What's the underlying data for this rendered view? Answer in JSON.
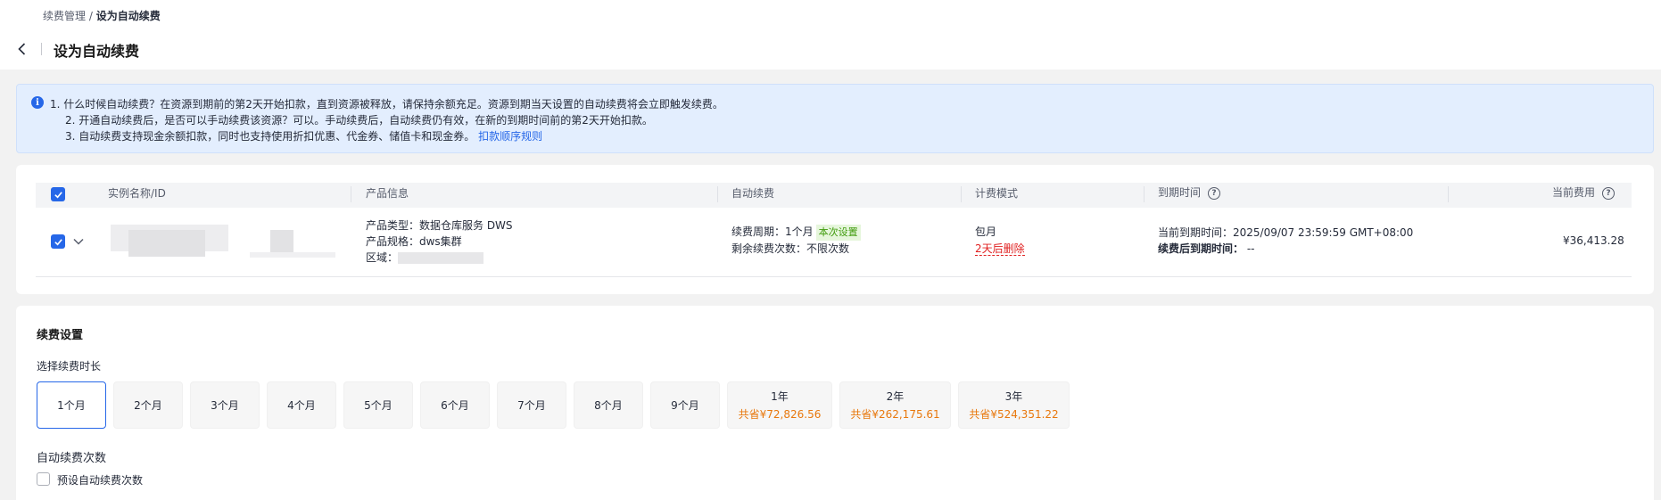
{
  "breadcrumb": {
    "parent": "续费管理",
    "sep": "/",
    "current": "设为自动续费"
  },
  "page_title": "设为自动续费",
  "info": {
    "line1": "1. 什么时候自动续费？在资源到期前的第2天开始扣款，直到资源被释放，请保持余额充足。资源到期当天设置的自动续费将会立即触发续费。",
    "line2": "2. 开通自动续费后，是否可以手动续费该资源？可以。手动续费后，自动续费仍有效，在新的到期时间前的第2天开始扣款。",
    "line3": "3. 自动续费支持现金余额扣款，同时也支持使用折扣优惠、代金券、储值卡和现金券。",
    "line3_link": "扣款顺序规则"
  },
  "table": {
    "headers": {
      "instance": "实例名称/ID",
      "product": "产品信息",
      "auto_renew": "自动续费",
      "billing": "计费模式",
      "expire": "到期时间",
      "fee": "当前费用"
    },
    "row": {
      "product_type": "产品类型：数据仓库服务 DWS",
      "product_spec": "产品规格：dws集群",
      "region_label": "区域：",
      "renew_period": "续费周期：1个月",
      "renew_tag": "本次设置",
      "renew_times": "剩余续费次数：不限次数",
      "billing_mode": "包月",
      "billing_delete": "2天后删除",
      "expire_current": "当前到期时间：2025/09/07 23:59:59 GMT+08:00",
      "expire_after_label": "续费后到期时间：",
      "expire_after_value": "--",
      "fee": "¥36,413.28"
    }
  },
  "settings": {
    "title": "续费设置",
    "duration_label": "选择续费时长",
    "options": [
      {
        "label": "1个月",
        "save": ""
      },
      {
        "label": "2个月",
        "save": ""
      },
      {
        "label": "3个月",
        "save": ""
      },
      {
        "label": "4个月",
        "save": ""
      },
      {
        "label": "5个月",
        "save": ""
      },
      {
        "label": "6个月",
        "save": ""
      },
      {
        "label": "7个月",
        "save": ""
      },
      {
        "label": "8个月",
        "save": ""
      },
      {
        "label": "9个月",
        "save": ""
      },
      {
        "label": "1年",
        "save": "共省¥72,826.56"
      },
      {
        "label": "2年",
        "save": "共省¥262,175.61"
      },
      {
        "label": "3年",
        "save": "共省¥524,351.22"
      }
    ],
    "selected_option": "1个月",
    "times_label": "自动续费次数",
    "preset_checkbox_label": "预设自动续费次数"
  },
  "colors": {
    "primary": "#2667e8",
    "savings": "#e8780d",
    "danger": "#e02020",
    "tag_green": "#3f9b0b"
  }
}
